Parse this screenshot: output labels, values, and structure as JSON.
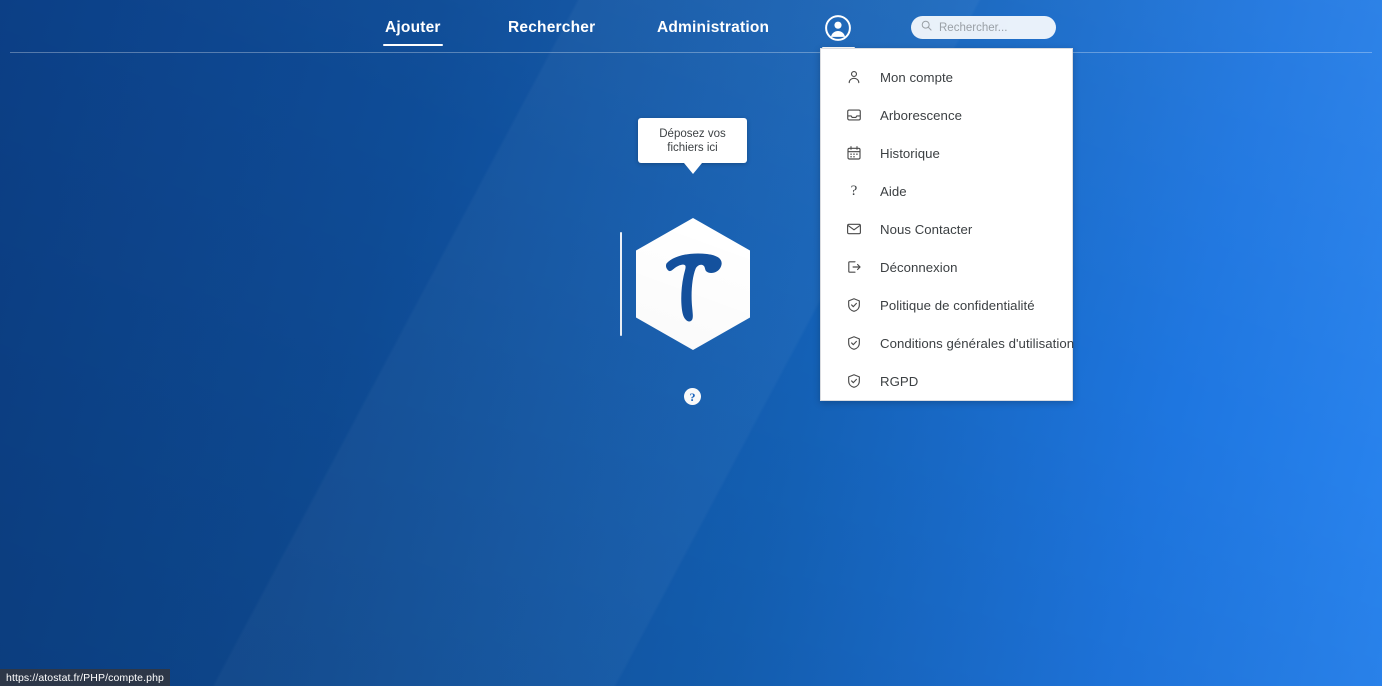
{
  "nav": {
    "items": [
      {
        "label": "Ajouter",
        "active": true
      },
      {
        "label": "Rechercher",
        "active": false
      },
      {
        "label": "Administration",
        "active": false
      }
    ]
  },
  "search": {
    "placeholder": "Rechercher...",
    "value": "",
    "icon": "search-icon"
  },
  "account": {
    "icon": "account-circle-icon",
    "expanded": true
  },
  "menu": {
    "items": [
      {
        "label": "Mon compte",
        "icon": "person-icon"
      },
      {
        "label": "Arborescence",
        "icon": "inbox-tray-icon"
      },
      {
        "label": "Historique",
        "icon": "calendar-icon"
      },
      {
        "label": "Aide",
        "icon": "question-mark-icon"
      },
      {
        "label": "Nous Contacter",
        "icon": "envelope-icon"
      },
      {
        "label": "Déconnexion",
        "icon": "logout-icon"
      },
      {
        "label": "Politique de confidentialité",
        "icon": "shield-check-icon"
      },
      {
        "label": "Conditions générales d'utilisation",
        "icon": "shield-check-icon"
      },
      {
        "label": "RGPD",
        "icon": "shield-check-icon"
      }
    ]
  },
  "stage": {
    "tooltip_line1": "Déposez vos",
    "tooltip_line2": "fichiers ici",
    "logo_letter": "T",
    "help_label": "?"
  },
  "statusbar": {
    "url": "https://atostat.fr/PHP/compte.php"
  },
  "colors": {
    "background_dark": "#0c3f86",
    "background_light": "#2a85f0",
    "panel_background": "#ffffff",
    "panel_border": "#dadce0",
    "text_on_panel": "#3c4043",
    "text_on_background": "#ffffff",
    "statusbar_background": "#2d3748",
    "logo_blue": "#14519e"
  }
}
